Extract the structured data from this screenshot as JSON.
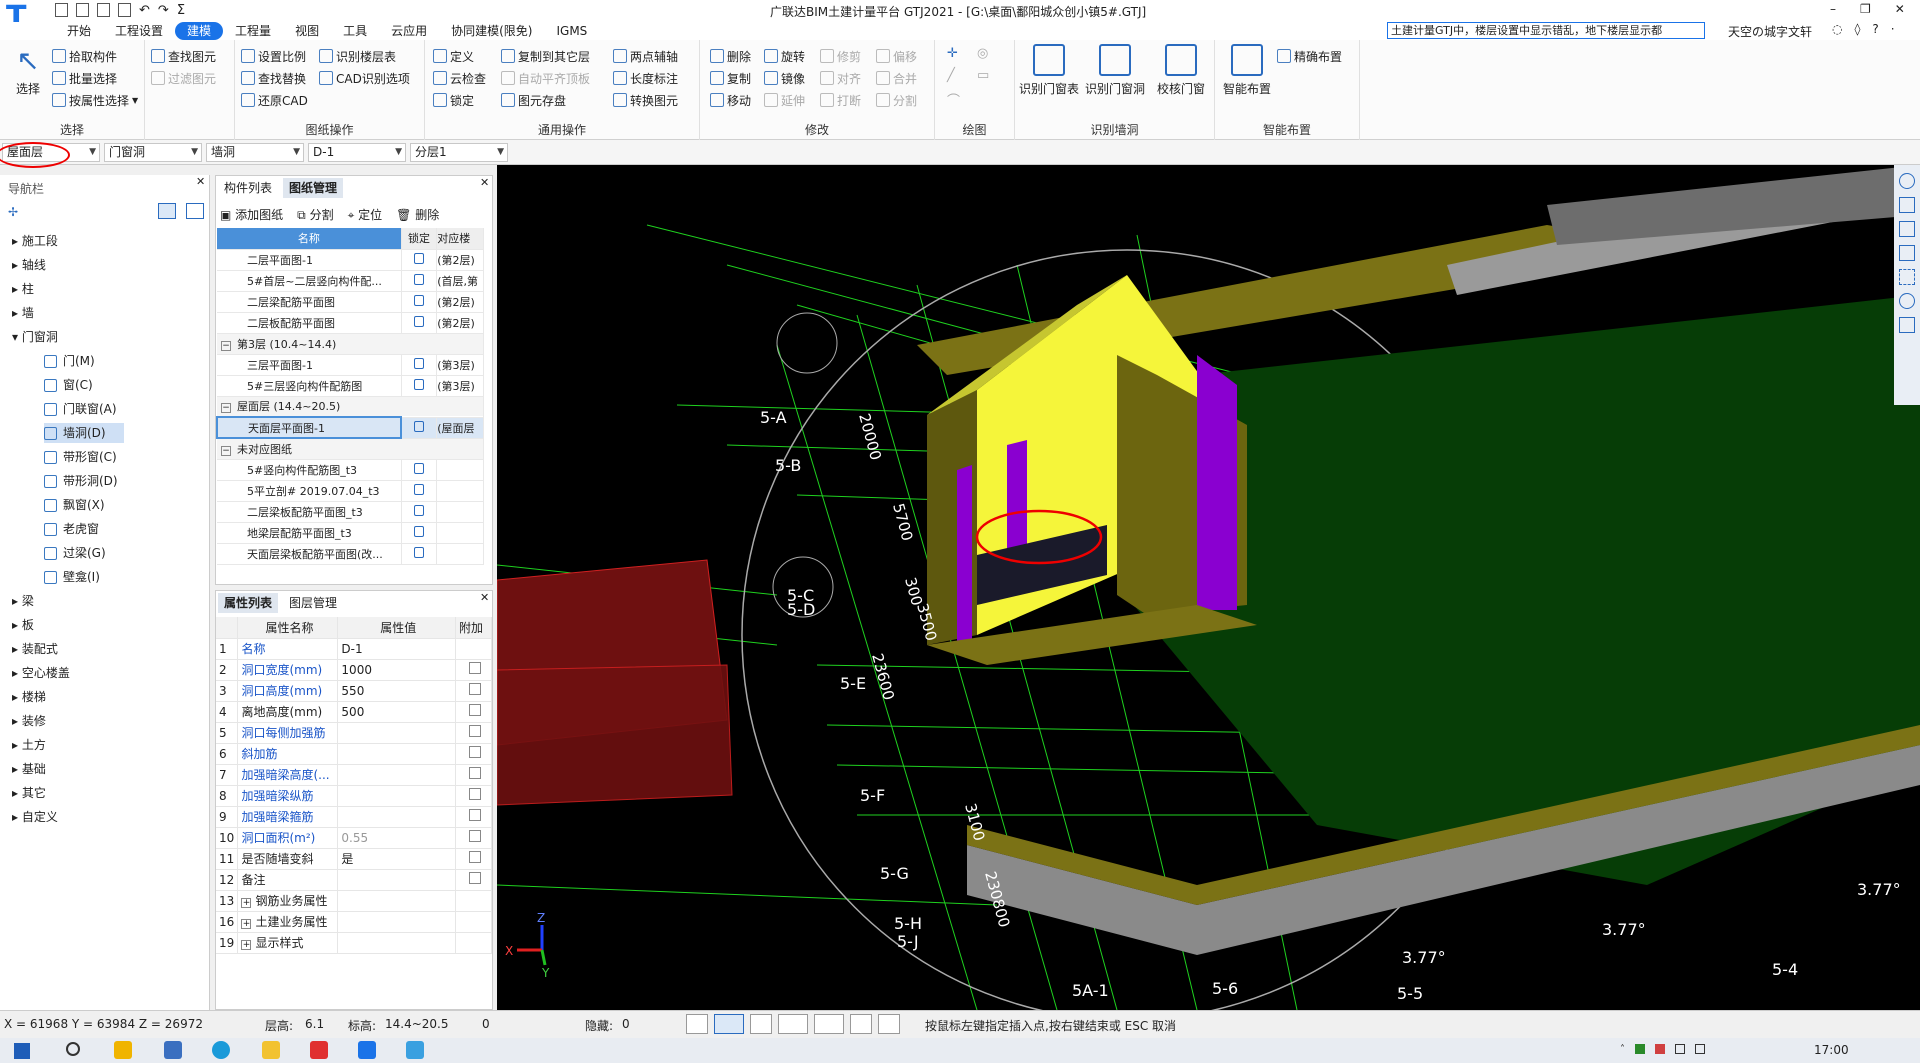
{
  "window": {
    "title": "广联达BIM土建计量平台 GTJ2021 - [G:\\桌面\\鄱阳城众创小镇5#.GTJ]",
    "search_text": "土建计量GTJ中，楼层设置中显示错乱，地下楼层显示都",
    "account": "天空の城字文轩"
  },
  "menu": [
    "开始",
    "工程设置",
    "建模",
    "工程量",
    "视图",
    "工具",
    "云应用",
    "协同建模(限免)",
    "IGMS"
  ],
  "menu_active": "建模",
  "ribbon": {
    "select": {
      "label": "选择",
      "big": "选择",
      "items": [
        "拾取构件",
        "批量选择",
        "按属性选择"
      ],
      "group": "选择"
    },
    "find": {
      "items": [
        "查找图元",
        "过滤图元"
      ]
    },
    "drawing_ops": {
      "items": [
        "设置比例",
        "识别楼层表",
        "查找替换",
        "CAD识别选项",
        "还原CAD"
      ],
      "group": "图纸操作"
    },
    "common": {
      "items": [
        "定义",
        "复制到其它层",
        "两点辅轴",
        "云检查",
        "自动平齐顶板",
        "长度标注",
        "锁定",
        "图元存盘",
        "转换图元"
      ],
      "group": "通用操作"
    },
    "modify": {
      "items": [
        "删除",
        "旋转",
        "修剪",
        "偏移",
        "复制",
        "镜像",
        "对齐",
        "合并",
        "移动",
        "延伸",
        "打断",
        "分割"
      ],
      "group": "修改"
    },
    "draw": {
      "group": "绘图"
    },
    "recognize": {
      "items": [
        "识别门窗表",
        "识别门窗洞",
        "校核门窗"
      ],
      "group": "识别墙洞"
    },
    "smart": {
      "items": [
        "智能布置",
        "精确布置"
      ],
      "group": "智能布置"
    }
  },
  "selectors": [
    "屋面层",
    "门窗洞",
    "墙洞",
    "D-1",
    "分层1"
  ],
  "nav": {
    "title": "导航栏",
    "items": [
      "施工段",
      "轴线",
      "柱",
      "墙",
      "门窗洞",
      "梁",
      "板",
      "装配式",
      "空心楼盖",
      "楼梯",
      "装修",
      "土方",
      "基础",
      "其它",
      "自定义"
    ],
    "sub_items": [
      "门(M)",
      "窗(C)",
      "门联窗(A)",
      "墙洞(D)",
      "带形窗(C)",
      "带形洞(D)",
      "飘窗(X)",
      "老虎窗",
      "过梁(G)",
      "壁龛(I)"
    ],
    "selected_sub": "墙洞(D)"
  },
  "drawing_panel": {
    "tabs": [
      "构件列表",
      "图纸管理"
    ],
    "active_tab": "图纸管理",
    "toolbar": [
      "添加图纸",
      "分割",
      "定位",
      "删除"
    ],
    "columns": [
      "名称",
      "锁定",
      "对应楼"
    ],
    "rows": [
      {
        "name": "二层平面图-1",
        "floor": "(第2层)",
        "group": false
      },
      {
        "name": "5#首层~二层竖向构件配...",
        "floor": "(首层,第",
        "group": false
      },
      {
        "name": "二层梁配筋平面图",
        "floor": "(第2层)",
        "group": false
      },
      {
        "name": "二层板配筋平面图",
        "floor": "(第2层)",
        "group": false
      },
      {
        "name": "第3层 (10.4~14.4)",
        "floor": "",
        "group": true
      },
      {
        "name": "三层平面图-1",
        "floor": "(第3层)",
        "group": false
      },
      {
        "name": "5#三层竖向构件配筋图",
        "floor": "(第3层)",
        "group": false
      },
      {
        "name": "屋面层 (14.4~20.5)",
        "floor": "",
        "group": true
      },
      {
        "name": "天面层平面图-1",
        "floor": "(屋面层",
        "group": false
      },
      {
        "name": "未对应图纸",
        "floor": "",
        "group": true
      },
      {
        "name": "5#竖向构件配筋图_t3",
        "floor": "",
        "group": false
      },
      {
        "name": "5平立剖# 2019.07.04_t3",
        "floor": "",
        "group": false
      },
      {
        "name": "二层梁板配筋平面图_t3",
        "floor": "",
        "group": false
      },
      {
        "name": "地梁层配筋平面图_t3",
        "floor": "",
        "group": false
      },
      {
        "name": "天面层梁板配筋平面图(改...",
        "floor": "",
        "group": false
      }
    ]
  },
  "property_panel": {
    "tabs": [
      "属性列表",
      "图层管理"
    ],
    "columns": [
      "属性名称",
      "属性值",
      "附加"
    ],
    "rows": [
      {
        "no": "1",
        "name": "名称",
        "value": "D-1",
        "blue": true,
        "check": false
      },
      {
        "no": "2",
        "name": "洞口宽度(mm)",
        "value": "1000",
        "blue": true,
        "check": true
      },
      {
        "no": "3",
        "name": "洞口高度(mm)",
        "value": "550",
        "blue": true,
        "check": true
      },
      {
        "no": "4",
        "name": "离地高度(mm)",
        "value": "500",
        "blue": false,
        "check": true
      },
      {
        "no": "5",
        "name": "洞口每侧加强筋",
        "value": "",
        "blue": true,
        "check": true
      },
      {
        "no": "6",
        "name": "斜加筋",
        "value": "",
        "blue": true,
        "check": true
      },
      {
        "no": "7",
        "name": "加强暗梁高度(...",
        "value": "",
        "blue": true,
        "check": true
      },
      {
        "no": "8",
        "name": "加强暗梁纵筋",
        "value": "",
        "blue": true,
        "check": true
      },
      {
        "no": "9",
        "name": "加强暗梁箍筋",
        "value": "",
        "blue": true,
        "check": true
      },
      {
        "no": "10",
        "name": "洞口面积(m²)",
        "value": "0.55",
        "blue": true,
        "check": true
      },
      {
        "no": "11",
        "name": "是否随墙变斜",
        "value": "是",
        "blue": false,
        "check": true
      },
      {
        "no": "12",
        "name": "备注",
        "value": "",
        "blue": false,
        "check": true
      },
      {
        "no": "13",
        "name": "钢筋业务属性",
        "value": "",
        "blue": false,
        "check": false
      },
      {
        "no": "16",
        "name": "土建业务属性",
        "value": "",
        "blue": false,
        "check": false
      },
      {
        "no": "19",
        "name": "显示样式",
        "value": "",
        "blue": false,
        "check": false
      }
    ]
  },
  "viewport": {
    "axis_labels": [
      "5-A",
      "5-B",
      "5-C",
      "5-D",
      "5-E",
      "5-F",
      "5-G",
      "5-H",
      "5-J",
      "5A-1",
      "5-6",
      "5-5",
      "5-4"
    ],
    "dims": [
      "20000",
      "5700",
      "300",
      "3500",
      "23600",
      "3100",
      "230800"
    ],
    "angles": [
      "3.77°",
      "3.77°",
      "3.77°"
    ],
    "triad": {
      "z": "Z",
      "y": "Y",
      "x": "X"
    }
  },
  "status": {
    "coords": "X = 61968 Y = 63984 Z = 26972",
    "floor_height_label": "层高:",
    "floor_height": "6.1",
    "elevation_label": "标高:",
    "elevation": "14.4~20.5",
    "zero": "0",
    "hidden_label": "隐藏:",
    "hidden": "0",
    "hint": "按鼠标左键指定插入点,按右键结束或 ESC 取消"
  },
  "taskbar": {
    "time": "17:00"
  }
}
